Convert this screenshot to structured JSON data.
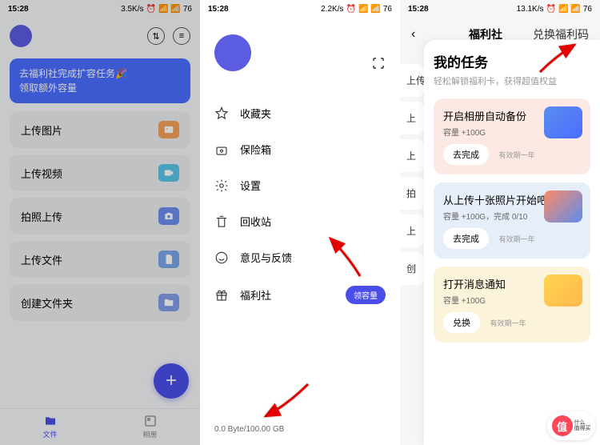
{
  "status": {
    "time": "15:28",
    "speed1": "3.5K/s",
    "speed2": "2.2K/s",
    "speed3": "13.1K/s",
    "battery": "76"
  },
  "screen1": {
    "promo_line1": "去福利社完成扩容任务🎉",
    "promo_line2": "领取额外容量",
    "items": [
      {
        "label": "上传图片",
        "icon": "image-icon",
        "color": "#f5a05a"
      },
      {
        "label": "上传视频",
        "icon": "video-icon",
        "color": "#5bc5e8"
      },
      {
        "label": "拍照上传",
        "icon": "camera-icon",
        "color": "#6b8def"
      },
      {
        "label": "上传文件",
        "icon": "file-icon",
        "color": "#7aa5e8"
      },
      {
        "label": "创建文件夹",
        "icon": "folder-add-icon",
        "color": "#809ee8"
      }
    ],
    "nav": {
      "files": "文件",
      "album": "相册"
    }
  },
  "screen2": {
    "menu": [
      {
        "label": "收藏夹",
        "icon": "star-icon"
      },
      {
        "label": "保险箱",
        "icon": "lock-icon"
      },
      {
        "label": "设置",
        "icon": "gear-icon"
      },
      {
        "label": "回收站",
        "icon": "trash-icon"
      },
      {
        "label": "意见与反馈",
        "icon": "smile-icon"
      },
      {
        "label": "福利社",
        "icon": "gift-icon",
        "badge": "领容量"
      }
    ],
    "storage": "0.0 Byte/100.00 GB"
  },
  "screen3": {
    "tabs": {
      "left": "福利社",
      "right": "兑换福利码"
    },
    "partial": [
      "上传",
      "上",
      "上",
      "拍",
      "上",
      "创"
    ],
    "panel_title": "我的任务",
    "panel_sub": "轻松解锁福利卡，获得超值权益",
    "tasks": [
      {
        "title": "开启相册自动备份",
        "sub": "容量 +100G",
        "btn": "去完成",
        "expire": "有效期一年"
      },
      {
        "title": "从上传十张照片开始吧",
        "sub": "容量 +100G，完成 0/10",
        "btn": "去完成",
        "expire": "有效期一年"
      },
      {
        "title": "打开消息通知",
        "sub": "容量 +100G",
        "btn": "兑换",
        "expire": "有效期一年"
      }
    ]
  },
  "watermark": {
    "char": "值",
    "text1": "什么",
    "text2": "值得买"
  }
}
